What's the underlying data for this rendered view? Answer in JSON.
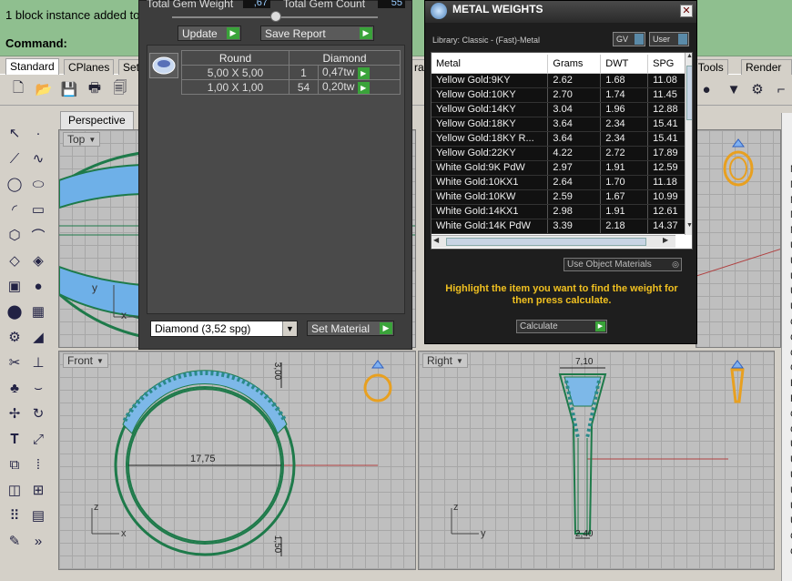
{
  "command": {
    "history": "1 block instance added to",
    "prompt": "Command:"
  },
  "toolbar_tabs": [
    "Standard",
    "CPlanes",
    "Set",
    "rar",
    "h Tools",
    "Render To"
  ],
  "viewports": {
    "perspective_tab": "Perspective",
    "top": "Top",
    "front": "Front",
    "right": "Right",
    "front_dims": {
      "diameter": "17,75",
      "top": "3,00",
      "bottom": "1,50"
    },
    "right_dims": {
      "width": "7,10",
      "base": "2,40"
    },
    "axis": {
      "x": "x",
      "y": "y",
      "z": "z"
    }
  },
  "gem_dialog": {
    "total_gem_weight_label": "Total Gem Weight",
    "total_gem_weight": ",67",
    "total_gem_count_label": "Total Gem Count",
    "total_gem_count": "55",
    "update_button": "Update",
    "save_report_button": "Save Report",
    "table": {
      "headers": [
        "Round",
        "Diamond"
      ],
      "rows": [
        {
          "size": "5,00 X 5,00",
          "count": "1",
          "weight": "0,47tw"
        },
        {
          "size": "1,00 X 1,00",
          "count": "54",
          "weight": "0,20tw"
        }
      ]
    },
    "material_select": "Diamond    (3,52 spg)",
    "set_material_button": "Set Material"
  },
  "metal_dialog": {
    "title": "METAL WEIGHTS",
    "library": "Library: Classic - (Fast)-Metal",
    "toggle_gv": "GV",
    "toggle_user": "User",
    "columns": [
      "Metal",
      "Grams",
      "DWT",
      "SPG"
    ],
    "rows": [
      [
        "Yellow Gold:9KY",
        "2.62",
        "1.68",
        "11.08"
      ],
      [
        "Yellow Gold:10KY",
        "2.70",
        "1.74",
        "11.45"
      ],
      [
        "Yellow Gold:14KY",
        "3.04",
        "1.96",
        "12.88"
      ],
      [
        "Yellow Gold:18KY",
        "3.64",
        "2.34",
        "15.41"
      ],
      [
        "Yellow Gold:18KY R...",
        "3.64",
        "2.34",
        "15.41"
      ],
      [
        "Yellow Gold:22KY",
        "4.22",
        "2.72",
        "17.89"
      ],
      [
        "White Gold:9K PdW",
        "2.97",
        "1.91",
        "12.59"
      ],
      [
        "White Gold:10KX1",
        "2.64",
        "1.70",
        "11.18"
      ],
      [
        "White Gold:10KW",
        "2.59",
        "1.67",
        "10.99"
      ],
      [
        "White Gold:14KX1",
        "2.98",
        "1.91",
        "12.61"
      ],
      [
        "White Gold:14K PdW",
        "3.39",
        "2.18",
        "14.37"
      ]
    ],
    "use_object_materials": "Use Object Materials",
    "hint": "Highlight the item you want to find the weight for then press calculate.",
    "calculate_button": "Calculate"
  },
  "right_panel_letters": [
    "N",
    "N",
    "M",
    "N",
    "M",
    "U",
    "U",
    "U",
    "U",
    "U",
    "C",
    "C",
    "C",
    "C",
    "H",
    "F",
    "C",
    "C",
    "U",
    "U",
    "U",
    "U",
    "U",
    "U",
    "C",
    "C"
  ]
}
